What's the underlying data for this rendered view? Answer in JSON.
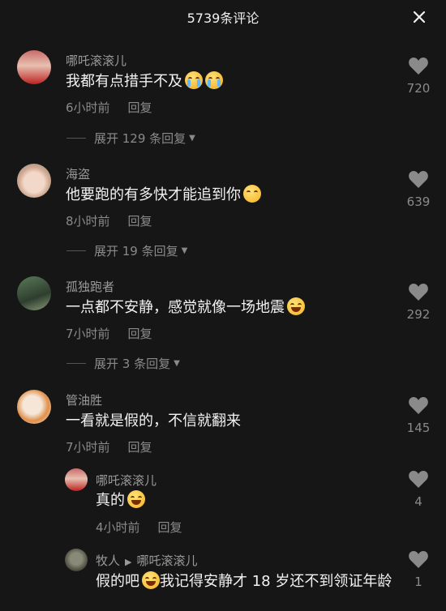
{
  "header": {
    "title": "5739条评论"
  },
  "comments": [
    {
      "user": "哪吒滚滚儿",
      "text": "我都有点措手不及",
      "emojis": [
        "cry",
        "cry"
      ],
      "time": "6小时前",
      "reply": "回复",
      "likes": "720",
      "expand": "展开 129 条回复",
      "avatar_colors": [
        "#d9a3a3",
        "#c23a3a"
      ]
    },
    {
      "user": "海盗",
      "text": "他要跑的有多快才能追到你",
      "emojis": [
        "kiss"
      ],
      "time": "8小时前",
      "reply": "回复",
      "likes": "639",
      "expand": "展开 19 条回复",
      "avatar_colors": [
        "#e8d0c0",
        "#3aa3a3"
      ]
    },
    {
      "user": "孤独跑者",
      "text": "一点都不安静，感觉就像一场地震",
      "emojis": [
        "laugh"
      ],
      "time": "7小时前",
      "reply": "回复",
      "likes": "292",
      "expand": "展开 3 条回复",
      "avatar_colors": [
        "#4a6a4a",
        "#7a8a6a"
      ]
    },
    {
      "user": "管油胜",
      "text": "一看就是假的，不信就翻来",
      "emojis": [],
      "time": "7小时前",
      "reply": "回复",
      "likes": "145",
      "avatar_colors": [
        "#f0e0d0",
        "#e07a2a"
      ]
    }
  ],
  "replies": [
    {
      "user": "哪吒滚滚儿",
      "text": "真的",
      "emojis": [
        "laugh"
      ],
      "time": "4小时前",
      "reply": "回复",
      "likes": "4",
      "avatar_colors": [
        "#d9a3a3",
        "#c23a3a"
      ]
    },
    {
      "user": "牧人",
      "reply_to": "哪吒滚滚儿",
      "text_a": "假的吧",
      "text_b": "我记得安静才 18 岁还不到领证年龄",
      "emojis": [
        "laugh"
      ],
      "likes": "1",
      "avatar_colors": [
        "#6a6a5a",
        "#3a3a30"
      ]
    }
  ]
}
